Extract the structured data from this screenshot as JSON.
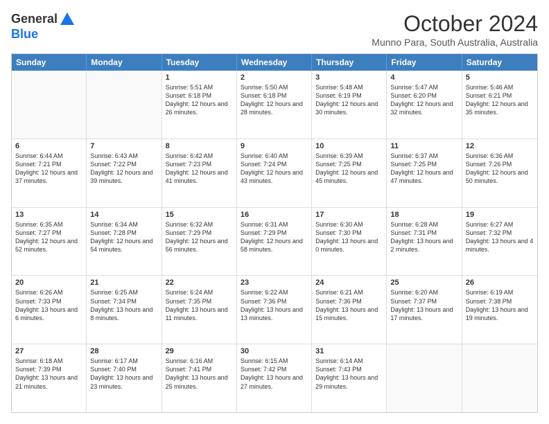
{
  "logo": {
    "line1": "General",
    "line2": "Blue"
  },
  "header": {
    "title": "October 2024",
    "subtitle": "Munno Para, South Australia, Australia"
  },
  "days": [
    "Sunday",
    "Monday",
    "Tuesday",
    "Wednesday",
    "Thursday",
    "Friday",
    "Saturday"
  ],
  "weeks": [
    [
      {
        "day": "",
        "info": ""
      },
      {
        "day": "",
        "info": ""
      },
      {
        "day": "1",
        "info": "Sunrise: 5:51 AM\nSunset: 6:18 PM\nDaylight: 12 hours and 26 minutes."
      },
      {
        "day": "2",
        "info": "Sunrise: 5:50 AM\nSunset: 6:18 PM\nDaylight: 12 hours and 28 minutes."
      },
      {
        "day": "3",
        "info": "Sunrise: 5:48 AM\nSunset: 6:19 PM\nDaylight: 12 hours and 30 minutes."
      },
      {
        "day": "4",
        "info": "Sunrise: 5:47 AM\nSunset: 6:20 PM\nDaylight: 12 hours and 32 minutes."
      },
      {
        "day": "5",
        "info": "Sunrise: 5:46 AM\nSunset: 6:21 PM\nDaylight: 12 hours and 35 minutes."
      }
    ],
    [
      {
        "day": "6",
        "info": "Sunrise: 6:44 AM\nSunset: 7:21 PM\nDaylight: 12 hours and 37 minutes."
      },
      {
        "day": "7",
        "info": "Sunrise: 6:43 AM\nSunset: 7:22 PM\nDaylight: 12 hours and 39 minutes."
      },
      {
        "day": "8",
        "info": "Sunrise: 6:42 AM\nSunset: 7:23 PM\nDaylight: 12 hours and 41 minutes."
      },
      {
        "day": "9",
        "info": "Sunrise: 6:40 AM\nSunset: 7:24 PM\nDaylight: 12 hours and 43 minutes."
      },
      {
        "day": "10",
        "info": "Sunrise: 6:39 AM\nSunset: 7:25 PM\nDaylight: 12 hours and 45 minutes."
      },
      {
        "day": "11",
        "info": "Sunrise: 6:37 AM\nSunset: 7:25 PM\nDaylight: 12 hours and 47 minutes."
      },
      {
        "day": "12",
        "info": "Sunrise: 6:36 AM\nSunset: 7:26 PM\nDaylight: 12 hours and 50 minutes."
      }
    ],
    [
      {
        "day": "13",
        "info": "Sunrise: 6:35 AM\nSunset: 7:27 PM\nDaylight: 12 hours and 52 minutes."
      },
      {
        "day": "14",
        "info": "Sunrise: 6:34 AM\nSunset: 7:28 PM\nDaylight: 12 hours and 54 minutes."
      },
      {
        "day": "15",
        "info": "Sunrise: 6:32 AM\nSunset: 7:29 PM\nDaylight: 12 hours and 56 minutes."
      },
      {
        "day": "16",
        "info": "Sunrise: 6:31 AM\nSunset: 7:29 PM\nDaylight: 12 hours and 58 minutes."
      },
      {
        "day": "17",
        "info": "Sunrise: 6:30 AM\nSunset: 7:30 PM\nDaylight: 13 hours and 0 minutes."
      },
      {
        "day": "18",
        "info": "Sunrise: 6:28 AM\nSunset: 7:31 PM\nDaylight: 13 hours and 2 minutes."
      },
      {
        "day": "19",
        "info": "Sunrise: 6:27 AM\nSunset: 7:32 PM\nDaylight: 13 hours and 4 minutes."
      }
    ],
    [
      {
        "day": "20",
        "info": "Sunrise: 6:26 AM\nSunset: 7:33 PM\nDaylight: 13 hours and 6 minutes."
      },
      {
        "day": "21",
        "info": "Sunrise: 6:25 AM\nSunset: 7:34 PM\nDaylight: 13 hours and 8 minutes."
      },
      {
        "day": "22",
        "info": "Sunrise: 6:24 AM\nSunset: 7:35 PM\nDaylight: 13 hours and 11 minutes."
      },
      {
        "day": "23",
        "info": "Sunrise: 6:22 AM\nSunset: 7:36 PM\nDaylight: 13 hours and 13 minutes."
      },
      {
        "day": "24",
        "info": "Sunrise: 6:21 AM\nSunset: 7:36 PM\nDaylight: 13 hours and 15 minutes."
      },
      {
        "day": "25",
        "info": "Sunrise: 6:20 AM\nSunset: 7:37 PM\nDaylight: 13 hours and 17 minutes."
      },
      {
        "day": "26",
        "info": "Sunrise: 6:19 AM\nSunset: 7:38 PM\nDaylight: 13 hours and 19 minutes."
      }
    ],
    [
      {
        "day": "27",
        "info": "Sunrise: 6:18 AM\nSunset: 7:39 PM\nDaylight: 13 hours and 21 minutes."
      },
      {
        "day": "28",
        "info": "Sunrise: 6:17 AM\nSunset: 7:40 PM\nDaylight: 13 hours and 23 minutes."
      },
      {
        "day": "29",
        "info": "Sunrise: 6:16 AM\nSunset: 7:41 PM\nDaylight: 13 hours and 25 minutes."
      },
      {
        "day": "30",
        "info": "Sunrise: 6:15 AM\nSunset: 7:42 PM\nDaylight: 13 hours and 27 minutes."
      },
      {
        "day": "31",
        "info": "Sunrise: 6:14 AM\nSunset: 7:43 PM\nDaylight: 13 hours and 29 minutes."
      },
      {
        "day": "",
        "info": ""
      },
      {
        "day": "",
        "info": ""
      }
    ]
  ]
}
